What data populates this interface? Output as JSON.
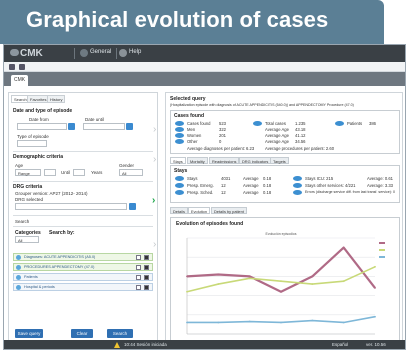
{
  "banner": {
    "title": "Graphical evolution of cases"
  },
  "topbar": {
    "logo": "CMK",
    "menu_general": "General",
    "menu_help": "Help"
  },
  "tabstrip": {
    "active_tab": "CMK"
  },
  "left_panel": {
    "tabs": [
      "Search",
      "Favorites",
      "History"
    ],
    "section_dates": "Date and type of episode",
    "date_from_label": "Date from",
    "date_to_label": "Date until",
    "date_from_value": "",
    "date_to_value": "",
    "episode_type_label": "Type of episode",
    "section_demo": "Demographic criteria",
    "age_label": "Age",
    "age_mode": "Range",
    "age_unit": "Years",
    "age_until": "Until",
    "gender_label": "Gender",
    "gender_value": "All",
    "section_drg": "DRG criteria",
    "grouper_label": "Grouper version: AP27 (2012- 2014)",
    "drg_selected_label": "DRG selected",
    "search_label": "Search",
    "categories_label": "Categories",
    "search_by_label": "Search by:",
    "categories_value": "All",
    "criteria": [
      "Diagnoses: ACUTE APPENDICITIS (A5.0)",
      "PROCEDURES APPENDECTOMY (47.0)",
      "Patients",
      "Hospital & periods"
    ],
    "btn_save": "Save query",
    "btn_clear": "Clear",
    "btn_search": "Search"
  },
  "right_panel": {
    "selected_query_title": "Selected query",
    "selected_query_text": "(Hospitalization episode with diagnosis of ACUTE APPENDICITIS (540.0)) and APPENDECTOMY Procedure (47.0)",
    "cases_found_title": "Cases found",
    "cases_left": [
      {
        "label": "Cases found",
        "value": "523"
      },
      {
        "label": "Men",
        "value": "322"
      },
      {
        "label": "Women",
        "value": "201"
      },
      {
        "label": "Other",
        "value": "0"
      }
    ],
    "avg_diag": "Average diagnoses per patient: 6.23",
    "cases_mid": [
      {
        "label": "Total cases",
        "value": "1.235"
      },
      {
        "label": "Average Age",
        "value": "43.18"
      },
      {
        "label": "Average Age",
        "value": "41.12"
      },
      {
        "label": "Average Age",
        "value": "34.56"
      }
    ],
    "avg_proc": "Average procedures per patient: 2.60",
    "patients": {
      "label": "Patients",
      "value": "386"
    },
    "tabs": [
      "Stays",
      "Mortality",
      "Readmissions",
      "DRG indicators",
      "Targets"
    ],
    "stays_title": "Stays",
    "stays_left": [
      {
        "label": "Stays",
        "value": "4031",
        "avg_label": "Average",
        "avg": "0.18"
      },
      {
        "label": "Presp. Emerg.",
        "value": "12",
        "avg_label": "Average",
        "avg": "0.18"
      },
      {
        "label": "Presp. Sched.",
        "value": "12",
        "avg_label": "Average",
        "avg": "0.18"
      }
    ],
    "stays_right": [
      "Stays ICU: 215",
      "Stays other services: 4/221",
      "Errors (discharge service diff. from last transf. service): 0"
    ],
    "stays_right_avg": [
      "Average: 0.61",
      "Average: 3.33"
    ],
    "subtabs": [
      "Details",
      "Evolution",
      "Details by patient"
    ],
    "chart_title": "Evolution of episodes found"
  },
  "status": {
    "center": "10:44 Sesión iniciada",
    "lang": "Español",
    "version": "ver. 10.56"
  },
  "colors": {
    "banner": "#5b7f95",
    "topbar": "#3a4045",
    "accent_blue": "#2f6fb2",
    "accent_green": "#1aa64a"
  },
  "chart_data": {
    "type": "line",
    "title": "Evolution of episodes found",
    "subtitle": "Evolución episodios",
    "x": [
      1,
      2,
      3,
      4,
      5,
      6,
      7
    ],
    "ylim": [
      0,
      100
    ],
    "grid": true,
    "legend": "right",
    "series": [
      {
        "values": [
          60,
          62,
          60,
          44,
          60,
          90,
          48
        ],
        "color": "#b06a86"
      },
      {
        "values": [
          44,
          52,
          58,
          55,
          52,
          55,
          70
        ],
        "color": "#c8d978"
      },
      {
        "values": [
          12,
          12,
          13,
          12,
          14,
          12,
          18
        ],
        "color": "#7eb7d8"
      }
    ]
  }
}
